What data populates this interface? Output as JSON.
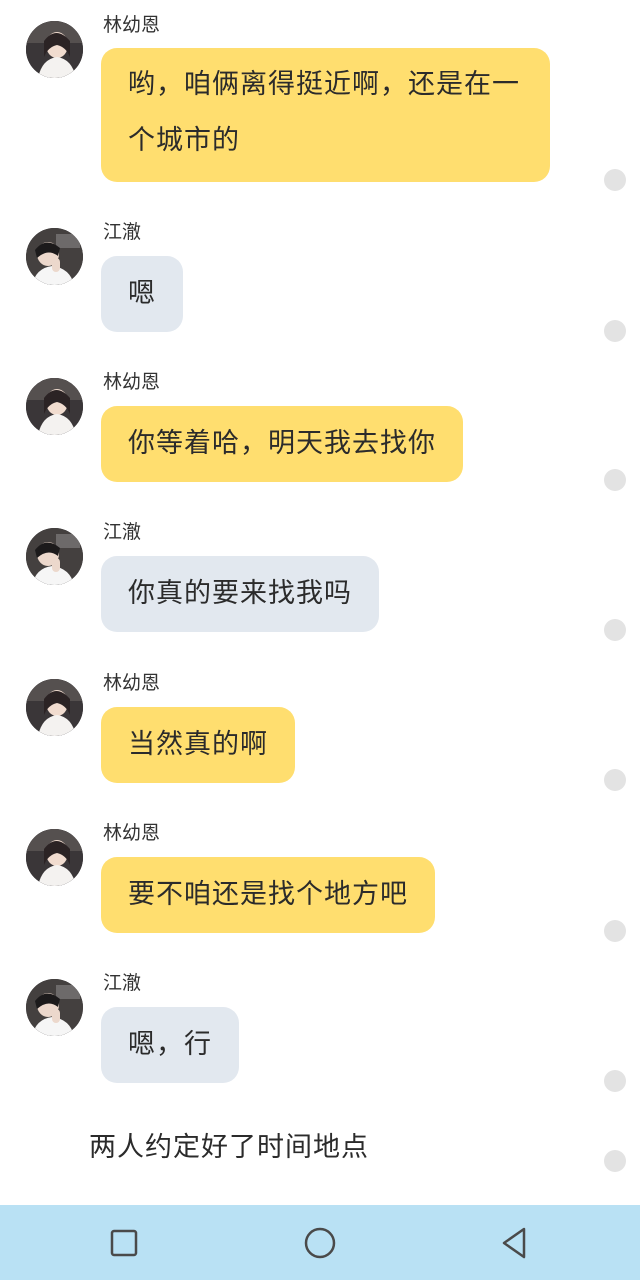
{
  "colors": {
    "bubble_self": "#ffde6f",
    "bubble_other": "#e2e8ef",
    "nav_bar": "#b9e1f4",
    "indicator_dot": "#e3e3e3"
  },
  "messages": [
    {
      "sender": "林幼恩",
      "avatar": "avatar-lin",
      "style": "yellow",
      "text": "哟，咱俩离得挺近啊，还是在一个城市的"
    },
    {
      "sender": "江澈",
      "avatar": "avatar-jiang",
      "style": "grey",
      "text": "嗯"
    },
    {
      "sender": "林幼恩",
      "avatar": "avatar-lin",
      "style": "yellow",
      "text": "你等着哈，明天我去找你"
    },
    {
      "sender": "江澈",
      "avatar": "avatar-jiang",
      "style": "grey",
      "text": "你真的要来找我吗"
    },
    {
      "sender": "林幼恩",
      "avatar": "avatar-lin",
      "style": "yellow",
      "text": "当然真的啊"
    },
    {
      "sender": "林幼恩",
      "avatar": "avatar-lin",
      "style": "yellow",
      "text": "要不咱还是找个地方吧"
    },
    {
      "sender": "江澈",
      "avatar": "avatar-jiang",
      "style": "grey",
      "text": "嗯，行"
    }
  ],
  "narration": "两人约定好了时间地点",
  "navbar": {
    "icons": [
      "recents-square-icon",
      "home-circle-icon",
      "back-triangle-icon"
    ]
  }
}
